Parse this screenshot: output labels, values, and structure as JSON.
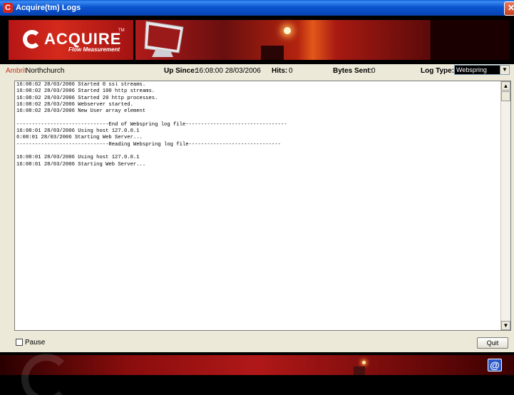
{
  "window": {
    "title": "Acquire(tm) Logs",
    "close_glyph": "✕"
  },
  "banner": {
    "logo_text": "ACQUIRE",
    "logo_tm": "TM",
    "logo_subtitle": "Flow Measurement"
  },
  "infobar": {
    "site_prefix": "Ambrit",
    "site_name": " Northchurch",
    "up_since_label": "Up Since:",
    "up_since_value": "16:08:00 28/03/2006",
    "hits_label": "Hits:",
    "hits_value": "0",
    "bytes_label": "Bytes Sent:",
    "bytes_value": "0",
    "log_type_label": "Log Type:",
    "log_type_selected": "Webspring"
  },
  "log": {
    "lines": [
      "16:08:02 28/03/2006 Started 0 ssl streams.",
      "16:08:02 28/03/2006 Started 100 http streams.",
      "16:08:02 28/03/2006 Started 20 http processes.",
      "16:08:02 28/03/2006 Webserver started.",
      "16:08:02 28/03/2006 New User array element",
      "",
      "------------------------------End of Webspring log file---------------------------------",
      "16:08:01 28/03/2006 Using host 127.0.0.1",
      "6:08:01 28/03/2006 Starting Web Server...",
      "------------------------------Reading Webspring log file------------------------------",
      "",
      "16:08:01 28/03/2006 Using host 127.0.0.1",
      "16:08:01 28/03/2006 Starting Web Server..."
    ]
  },
  "controls": {
    "pause_label": "Pause",
    "quit_label": "Quit"
  },
  "icons": {
    "app": "acquire-app-icon",
    "close": "close-icon",
    "dropdown": "chevron-down-icon",
    "scroll_up": "scroll-up-icon",
    "scroll_down": "scroll-down-icon",
    "at": "at-icon"
  },
  "colors": {
    "titlebar": "#0a55d0",
    "brand_red": "#c2301c",
    "background": "#ece9d8"
  }
}
